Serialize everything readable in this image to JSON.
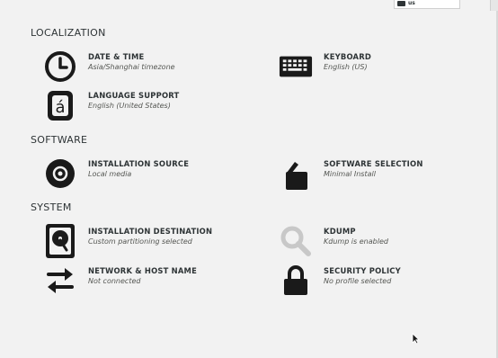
{
  "topbar": {
    "keyboard_layout": "us"
  },
  "sections": {
    "localization": "LOCALIZATION",
    "software": "SOFTWARE",
    "system": "SYSTEM"
  },
  "spokes": {
    "date_time": {
      "title": "DATE & TIME",
      "status": "Asia/Shanghai timezone",
      "icon": "clock-icon"
    },
    "keyboard": {
      "title": "KEYBOARD",
      "status": "English (US)",
      "icon": "keyboard-icon"
    },
    "language": {
      "title": "LANGUAGE SUPPORT",
      "status": "English (United States)",
      "icon": "language-icon"
    },
    "install_source": {
      "title": "INSTALLATION SOURCE",
      "status": "Local media",
      "icon": "disc-icon"
    },
    "software_selection": {
      "title": "SOFTWARE SELECTION",
      "status": "Minimal Install",
      "icon": "package-icon"
    },
    "install_destination": {
      "title": "INSTALLATION DESTINATION",
      "status": "Custom partitioning selected",
      "icon": "harddisk-icon"
    },
    "kdump": {
      "title": "KDUMP",
      "status": "Kdump is enabled",
      "icon": "search-icon"
    },
    "network": {
      "title": "NETWORK & HOST NAME",
      "status": "Not connected",
      "icon": "network-arrows-icon"
    },
    "security": {
      "title": "SECURITY POLICY",
      "status": "No profile selected",
      "icon": "padlock-icon"
    }
  },
  "colors": {
    "background": "#f2f2f2",
    "icon": "#1a1a1a",
    "disabled_icon": "#c8c8c8",
    "text": "#2e3436"
  }
}
